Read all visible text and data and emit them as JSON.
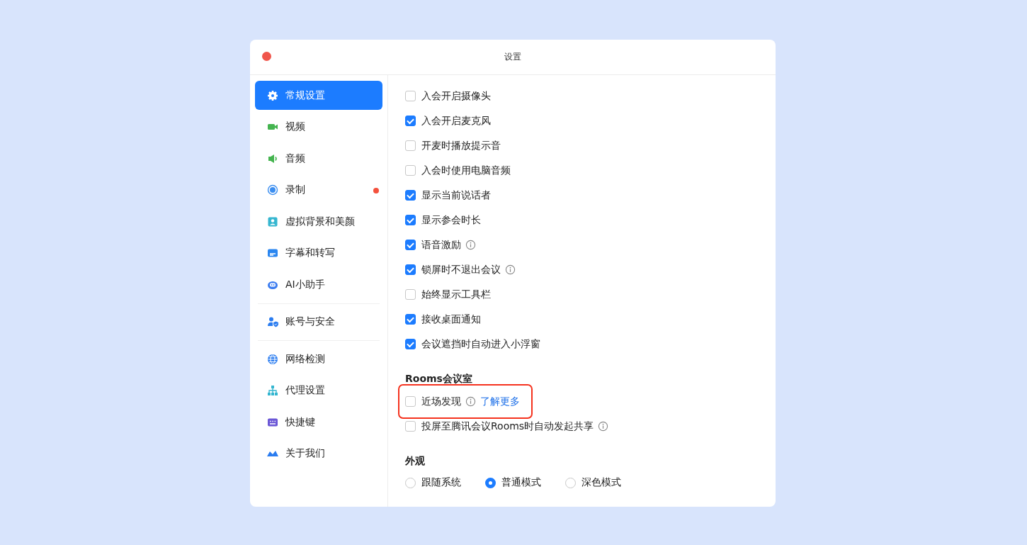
{
  "window": {
    "title": "设置"
  },
  "sidebar": {
    "groups": [
      [
        {
          "label": "常规设置",
          "selected": true,
          "dot": false
        },
        {
          "label": "视频",
          "selected": false,
          "dot": false
        },
        {
          "label": "音频",
          "selected": false,
          "dot": false
        },
        {
          "label": "录制",
          "selected": false,
          "dot": true
        },
        {
          "label": "虚拟背景和美颜",
          "selected": false,
          "dot": false
        },
        {
          "label": "字幕和转写",
          "selected": false,
          "dot": false
        },
        {
          "label": "AI小助手",
          "selected": false,
          "dot": false
        }
      ],
      [
        {
          "label": "账号与安全",
          "selected": false,
          "dot": false
        }
      ],
      [
        {
          "label": "网络检测",
          "selected": false,
          "dot": false
        },
        {
          "label": "代理设置",
          "selected": false,
          "dot": false
        },
        {
          "label": "快捷键",
          "selected": false,
          "dot": false
        },
        {
          "label": "关于我们",
          "selected": false,
          "dot": false
        }
      ]
    ]
  },
  "sections": [
    {
      "options": [
        {
          "kind": "checkbox",
          "label": "入会开启摄像头",
          "checked": false,
          "info": false
        },
        {
          "kind": "checkbox",
          "label": "入会开启麦克风",
          "checked": true,
          "info": false
        },
        {
          "kind": "checkbox",
          "label": "开麦时播放提示音",
          "checked": false,
          "info": false
        },
        {
          "kind": "checkbox",
          "label": "入会时使用电脑音频",
          "checked": false,
          "info": false
        },
        {
          "kind": "checkbox",
          "label": "显示当前说话者",
          "checked": true,
          "info": false
        },
        {
          "kind": "checkbox",
          "label": "显示参会时长",
          "checked": true,
          "info": false
        },
        {
          "kind": "checkbox",
          "label": "语音激励",
          "checked": true,
          "info": true
        },
        {
          "kind": "checkbox",
          "label": "锁屏时不退出会议",
          "checked": true,
          "info": true
        },
        {
          "kind": "checkbox",
          "label": "始终显示工具栏",
          "checked": false,
          "info": false
        },
        {
          "kind": "checkbox",
          "label": "接收桌面通知",
          "checked": true,
          "info": false
        },
        {
          "kind": "checkbox",
          "label": "会议遮挡时自动进入小浮窗",
          "checked": true,
          "info": false
        }
      ]
    },
    {
      "title": "Rooms会议室",
      "options": [
        {
          "kind": "checkbox",
          "label": "近场发现",
          "checked": false,
          "info": true,
          "link": "了解更多",
          "highlighted": true
        },
        {
          "kind": "checkbox",
          "label": "投屏至腾讯会议Rooms时自动发起共享",
          "checked": false,
          "info": true
        }
      ]
    },
    {
      "title": "外观",
      "options": [
        {
          "kind": "radio",
          "label": "跟随系统",
          "selected": false
        },
        {
          "kind": "radio",
          "label": "普通模式",
          "selected": true
        },
        {
          "kind": "radio",
          "label": "深色模式",
          "selected": false
        }
      ]
    }
  ]
}
